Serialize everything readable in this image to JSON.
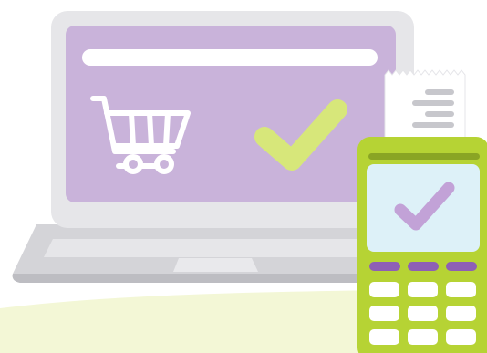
{
  "illustration": {
    "subject": "online-payment-confirmed",
    "icons": {
      "cart": "shopping-cart-icon",
      "laptop_check": "check-icon",
      "terminal_check": "check-icon",
      "receipt": "receipt-icon"
    },
    "colors": {
      "background_wave": "#f3f7d6",
      "laptop_frame": "#e6e6e9",
      "laptop_base": "#d4d4d8",
      "laptop_base_dark": "#bdbdc2",
      "screen": "#c9b3da",
      "search_bar": "#ffffff",
      "laptop_check": "#d7e77a",
      "terminal_body": "#b6d334",
      "terminal_screen": "#ddf1f8",
      "terminal_check": "#c2a2d7",
      "terminal_keys_top": "#8e5fb5",
      "terminal_keys": "#ffffff",
      "receipt": "#ffffff",
      "receipt_lines": "#c7c7cc"
    }
  }
}
